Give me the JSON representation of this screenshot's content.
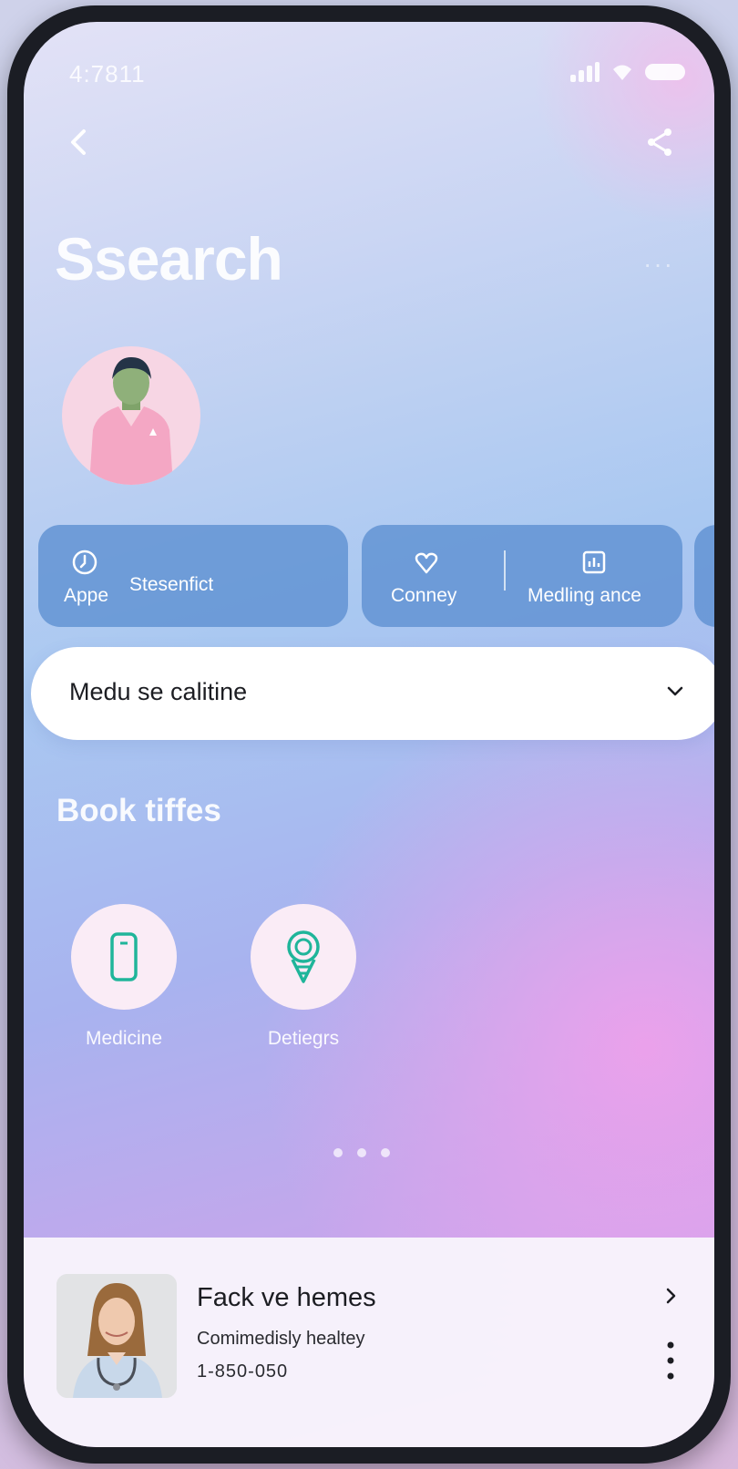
{
  "status_bar": {
    "time": "4:7811"
  },
  "header": {
    "title": "Ssearch",
    "more_dots": "···"
  },
  "chips": [
    {
      "label_a": "Appe",
      "label_b": "Stesenfict",
      "icon": "clock-icon"
    },
    {
      "label_a": "Conney",
      "label_b": "Medling ance",
      "icon_a": "heart-hand-icon",
      "icon_b": "calendar-chart-icon"
    }
  ],
  "dropdown": {
    "value": "Medu se calitine"
  },
  "section": {
    "title": "Book tiffes"
  },
  "categories": [
    {
      "label": "Medicine",
      "icon": "phone-device-icon"
    },
    {
      "label": "Detiegrs",
      "icon": "tree-icon"
    }
  ],
  "pager": {
    "count": 3
  },
  "doctor_card": {
    "name": "Fack ve hemes",
    "specialty": "Comimedisly healtey",
    "phone": "1-850-050"
  },
  "colors": {
    "chip_bg": "#5f91d2",
    "accent_teal": "#1fb59a",
    "title_white": "#ffffff"
  }
}
